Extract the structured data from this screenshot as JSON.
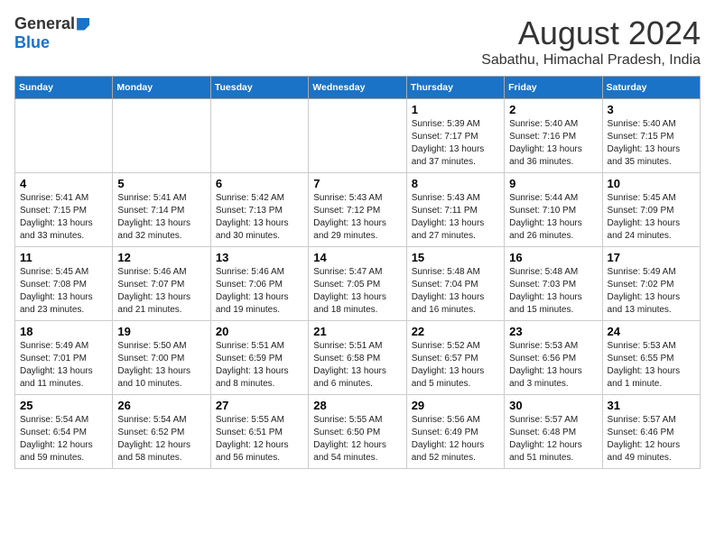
{
  "logo": {
    "general": "General",
    "blue": "Blue"
  },
  "header": {
    "title": "August 2024",
    "subtitle": "Sabathu, Himachal Pradesh, India"
  },
  "days_of_week": [
    "Sunday",
    "Monday",
    "Tuesday",
    "Wednesday",
    "Thursday",
    "Friday",
    "Saturday"
  ],
  "weeks": [
    [
      {
        "day": "",
        "info": ""
      },
      {
        "day": "",
        "info": ""
      },
      {
        "day": "",
        "info": ""
      },
      {
        "day": "",
        "info": ""
      },
      {
        "day": "1",
        "info": "Sunrise: 5:39 AM\nSunset: 7:17 PM\nDaylight: 13 hours\nand 37 minutes."
      },
      {
        "day": "2",
        "info": "Sunrise: 5:40 AM\nSunset: 7:16 PM\nDaylight: 13 hours\nand 36 minutes."
      },
      {
        "day": "3",
        "info": "Sunrise: 5:40 AM\nSunset: 7:15 PM\nDaylight: 13 hours\nand 35 minutes."
      }
    ],
    [
      {
        "day": "4",
        "info": "Sunrise: 5:41 AM\nSunset: 7:15 PM\nDaylight: 13 hours\nand 33 minutes."
      },
      {
        "day": "5",
        "info": "Sunrise: 5:41 AM\nSunset: 7:14 PM\nDaylight: 13 hours\nand 32 minutes."
      },
      {
        "day": "6",
        "info": "Sunrise: 5:42 AM\nSunset: 7:13 PM\nDaylight: 13 hours\nand 30 minutes."
      },
      {
        "day": "7",
        "info": "Sunrise: 5:43 AM\nSunset: 7:12 PM\nDaylight: 13 hours\nand 29 minutes."
      },
      {
        "day": "8",
        "info": "Sunrise: 5:43 AM\nSunset: 7:11 PM\nDaylight: 13 hours\nand 27 minutes."
      },
      {
        "day": "9",
        "info": "Sunrise: 5:44 AM\nSunset: 7:10 PM\nDaylight: 13 hours\nand 26 minutes."
      },
      {
        "day": "10",
        "info": "Sunrise: 5:45 AM\nSunset: 7:09 PM\nDaylight: 13 hours\nand 24 minutes."
      }
    ],
    [
      {
        "day": "11",
        "info": "Sunrise: 5:45 AM\nSunset: 7:08 PM\nDaylight: 13 hours\nand 23 minutes."
      },
      {
        "day": "12",
        "info": "Sunrise: 5:46 AM\nSunset: 7:07 PM\nDaylight: 13 hours\nand 21 minutes."
      },
      {
        "day": "13",
        "info": "Sunrise: 5:46 AM\nSunset: 7:06 PM\nDaylight: 13 hours\nand 19 minutes."
      },
      {
        "day": "14",
        "info": "Sunrise: 5:47 AM\nSunset: 7:05 PM\nDaylight: 13 hours\nand 18 minutes."
      },
      {
        "day": "15",
        "info": "Sunrise: 5:48 AM\nSunset: 7:04 PM\nDaylight: 13 hours\nand 16 minutes."
      },
      {
        "day": "16",
        "info": "Sunrise: 5:48 AM\nSunset: 7:03 PM\nDaylight: 13 hours\nand 15 minutes."
      },
      {
        "day": "17",
        "info": "Sunrise: 5:49 AM\nSunset: 7:02 PM\nDaylight: 13 hours\nand 13 minutes."
      }
    ],
    [
      {
        "day": "18",
        "info": "Sunrise: 5:49 AM\nSunset: 7:01 PM\nDaylight: 13 hours\nand 11 minutes."
      },
      {
        "day": "19",
        "info": "Sunrise: 5:50 AM\nSunset: 7:00 PM\nDaylight: 13 hours\nand 10 minutes."
      },
      {
        "day": "20",
        "info": "Sunrise: 5:51 AM\nSunset: 6:59 PM\nDaylight: 13 hours\nand 8 minutes."
      },
      {
        "day": "21",
        "info": "Sunrise: 5:51 AM\nSunset: 6:58 PM\nDaylight: 13 hours\nand 6 minutes."
      },
      {
        "day": "22",
        "info": "Sunrise: 5:52 AM\nSunset: 6:57 PM\nDaylight: 13 hours\nand 5 minutes."
      },
      {
        "day": "23",
        "info": "Sunrise: 5:53 AM\nSunset: 6:56 PM\nDaylight: 13 hours\nand 3 minutes."
      },
      {
        "day": "24",
        "info": "Sunrise: 5:53 AM\nSunset: 6:55 PM\nDaylight: 13 hours\nand 1 minute."
      }
    ],
    [
      {
        "day": "25",
        "info": "Sunrise: 5:54 AM\nSunset: 6:54 PM\nDaylight: 12 hours\nand 59 minutes."
      },
      {
        "day": "26",
        "info": "Sunrise: 5:54 AM\nSunset: 6:52 PM\nDaylight: 12 hours\nand 58 minutes."
      },
      {
        "day": "27",
        "info": "Sunrise: 5:55 AM\nSunset: 6:51 PM\nDaylight: 12 hours\nand 56 minutes."
      },
      {
        "day": "28",
        "info": "Sunrise: 5:55 AM\nSunset: 6:50 PM\nDaylight: 12 hours\nand 54 minutes."
      },
      {
        "day": "29",
        "info": "Sunrise: 5:56 AM\nSunset: 6:49 PM\nDaylight: 12 hours\nand 52 minutes."
      },
      {
        "day": "30",
        "info": "Sunrise: 5:57 AM\nSunset: 6:48 PM\nDaylight: 12 hours\nand 51 minutes."
      },
      {
        "day": "31",
        "info": "Sunrise: 5:57 AM\nSunset: 6:46 PM\nDaylight: 12 hours\nand 49 minutes."
      }
    ]
  ]
}
